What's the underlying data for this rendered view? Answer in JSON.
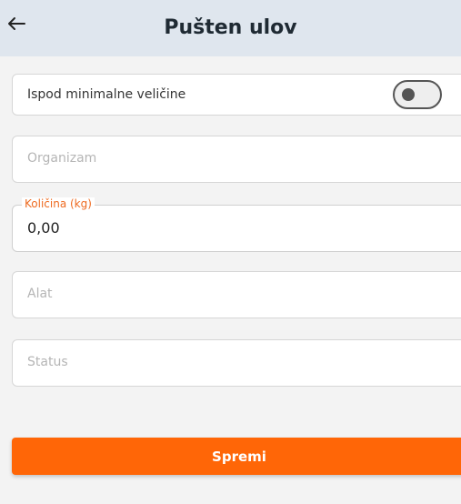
{
  "header": {
    "title": "Pušten ulov",
    "back_icon": "arrow-left-icon"
  },
  "toggle_row": {
    "label": "Ispod minimalne veličine",
    "state": "off"
  },
  "fields": {
    "organizam": {
      "placeholder": "Organizam",
      "value": ""
    },
    "kolicina": {
      "label": "Količina (kg)",
      "value": "0,00"
    },
    "alat": {
      "placeholder": "Alat",
      "value": ""
    },
    "status": {
      "placeholder": "Status",
      "value": ""
    }
  },
  "actions": {
    "save_label": "Spremi"
  },
  "colors": {
    "accent": "#ff6607",
    "header_bg": "#dfe6ee",
    "page_bg": "#f3f3f3"
  }
}
